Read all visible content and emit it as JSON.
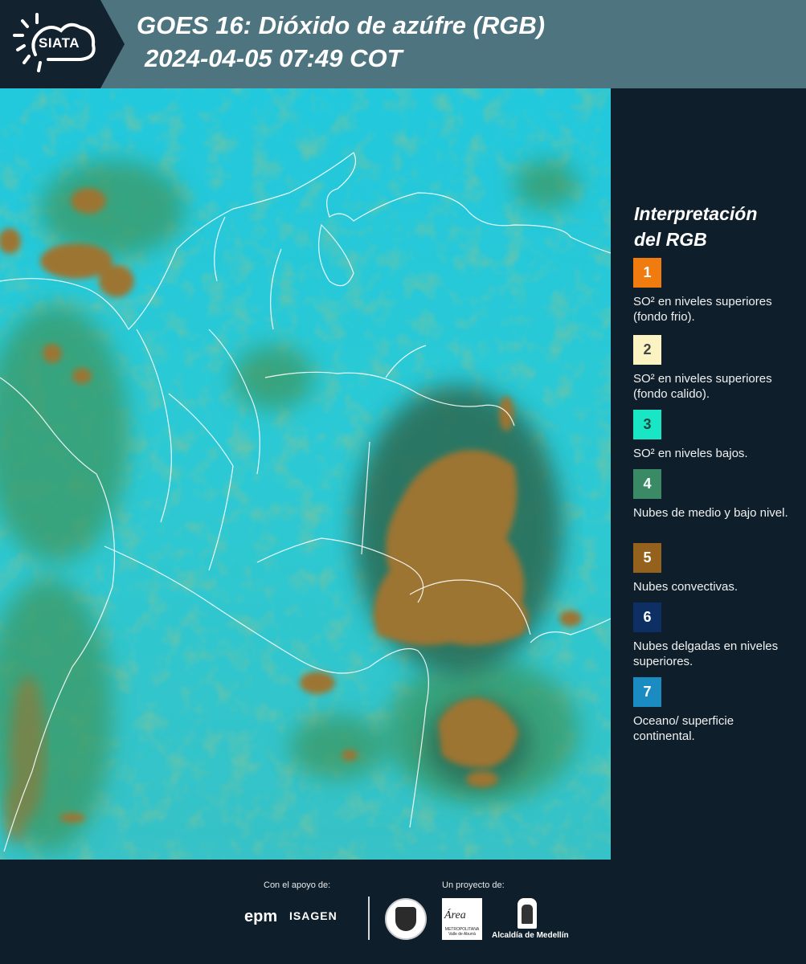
{
  "header": {
    "logo_text": "SIATA",
    "title_line1": "GOES 16: Dióxido de azúfre (RGB)",
    "title_line2": "2024-04-05 07:49 COT"
  },
  "legend": {
    "title_line1": "Interpretación",
    "title_line2": "del RGB",
    "items": [
      {
        "number": "1",
        "label": "SO² en niveles superiores (fondo frio).",
        "color": "#f07c10",
        "text_color": "#ffffff"
      },
      {
        "number": "2",
        "label": "SO² en niveles superiores (fondo calido).",
        "color": "#fbf3c2",
        "text_color": "#444444"
      },
      {
        "number": "3",
        "label": "SO² en niveles bajos.",
        "color": "#18e6c4",
        "text_color": "#1a4a46"
      },
      {
        "number": "4",
        "label": "Nubes de medio y bajo nivel.",
        "color": "#3b8a66",
        "text_color": "#ffffff"
      },
      {
        "number": "5",
        "label": "Nubes convectivas.",
        "color": "#94621c",
        "text_color": "#ffffff"
      },
      {
        "number": "6",
        "label": "Nubes delgadas en niveles superiores.",
        "color": "#0d2f63",
        "text_color": "#ffffff"
      },
      {
        "number": "7",
        "label": "Oceano/ superficie continental.",
        "color": "#1a8cc1",
        "text_color": "#ffffff"
      }
    ]
  },
  "footer": {
    "support_label": "Con el apoyo de:",
    "project_label": "Un proyecto de:",
    "sponsor_1": "epm",
    "sponsor_2": "ISAGEN",
    "partner_area": "Área",
    "partner_area_sub": "METROPOLITANA Valle de Aburrá",
    "partner_alcaldia": "Alcaldía de Medellín"
  },
  "colors": {
    "header_bg": "#4e7480",
    "panel_bg": "#0e1f2b",
    "map_base": "#1fc4d8",
    "convective": "#9a7436",
    "low_cloud": "#3f9a6a"
  },
  "icons": {
    "logo": "sun-cloud-icon",
    "seal": "medellin-seal-icon",
    "alcaldia": "alcaldia-emblem-icon"
  }
}
